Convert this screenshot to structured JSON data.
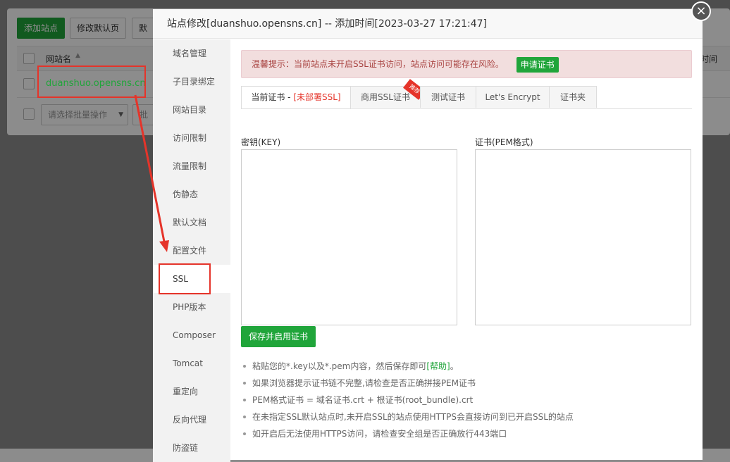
{
  "background": {
    "buttons": {
      "add_site": "添加站点",
      "edit_default": "修改默认页",
      "default_partial": "默认"
    },
    "table": {
      "col_site_name": "网站名",
      "col_time_partial": "时间"
    },
    "row_site": "duanshuo.opensns.cn",
    "batch_select_placeholder": "请选择批量操作",
    "batch_partial": "批量"
  },
  "modal": {
    "title": "站点修改[duanshuo.opensns.cn] -- 添加时间[2023-03-27 17:21:47]",
    "close_glyph": "×",
    "sidebar": [
      "域名管理",
      "子目录绑定",
      "网站目录",
      "访问限制",
      "流量限制",
      "伪静态",
      "默认文档",
      "配置文件",
      "SSL",
      "PHP版本",
      "Composer",
      "Tomcat",
      "重定向",
      "反向代理",
      "防盗链"
    ],
    "active_sidebar": "SSL",
    "alert_text": "温馨提示：当前站点未开启SSL证书访问，站点访问可能存在风险。",
    "alert_button": "申请证书",
    "tabs": {
      "current_prefix": "当前证书 - ",
      "current_status": "[未部署SSL]",
      "commercial": "商用SSL证书",
      "commercial_ribbon": "推荐",
      "test": "测试证书",
      "letsencrypt": "Let's Encrypt",
      "folder": "证书夹"
    },
    "key_label": "密钥(KEY)",
    "cert_label": "证书(PEM格式)",
    "key_value": "",
    "cert_value": "",
    "save_button": "保存并启用证书",
    "tips": {
      "tip1_text": "粘贴您的*.key以及*.pem内容，然后保存即可",
      "tip1_help": "[帮助]",
      "tip1_end": "。",
      "tip2": "如果浏览器提示证书链不完整,请检查是否正确拼接PEM证书",
      "tip3": "PEM格式证书 = 域名证书.crt + 根证书(root_bundle).crt",
      "tip4": "在未指定SSL默认站点时,未开启SSL的站点使用HTTPS会直接访问到已开启SSL的站点",
      "tip5": "如开启后无法使用HTTPS访问，请检查安全组是否正确放行443端口"
    }
  },
  "colors": {
    "accent_green": "#20a53a",
    "highlight_red": "#e5342a",
    "alert_bg": "#f2dede"
  }
}
